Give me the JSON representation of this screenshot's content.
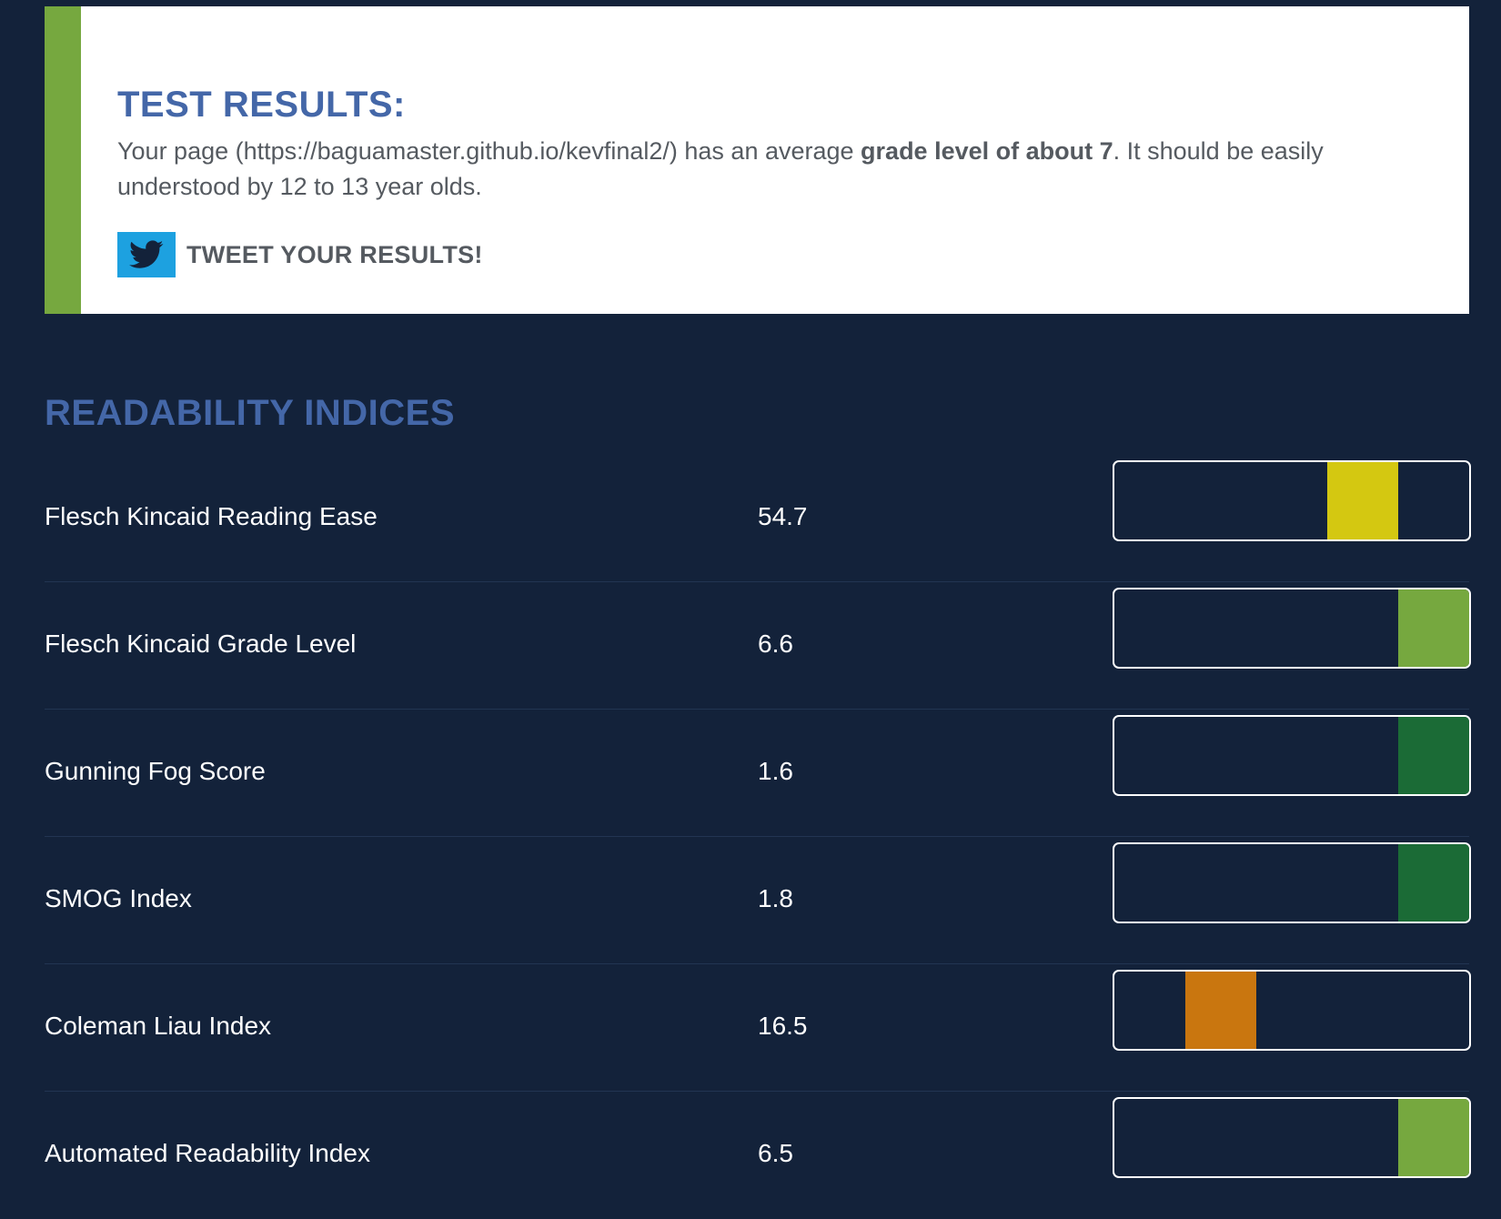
{
  "results": {
    "title": "TEST RESULTS:",
    "text_before": "Your page (https://baguamaster.github.io/kevfinal2/) has an average ",
    "text_bold": "grade level of about 7",
    "text_after": ". It should be easily understood by 12 to 13 year olds.",
    "tweet_label": "TWEET YOUR RESULTS!",
    "tweet_icon": "twitter-bird-icon",
    "accent_color": "#76a83f",
    "tweet_color": "#1da1e0"
  },
  "section_title": "READABILITY INDICES",
  "indices": [
    {
      "name": "Flesch Kincaid Reading Ease",
      "value": "54.7",
      "level": 4,
      "color": "#d4c811"
    },
    {
      "name": "Flesch Kincaid Grade Level",
      "value": "6.6",
      "level": 5,
      "color": "#76a83f"
    },
    {
      "name": "Gunning Fog Score",
      "value": "1.6",
      "level": 5,
      "color": "#1b6b36"
    },
    {
      "name": "SMOG Index",
      "value": "1.8",
      "level": 5,
      "color": "#1b6b36"
    },
    {
      "name": "Coleman Liau Index",
      "value": "16.5",
      "level": 2,
      "color": "#c9760f"
    },
    {
      "name": "Automated Readability Index",
      "value": "6.5",
      "level": 5,
      "color": "#76a83f"
    }
  ],
  "bar_segments": 5
}
